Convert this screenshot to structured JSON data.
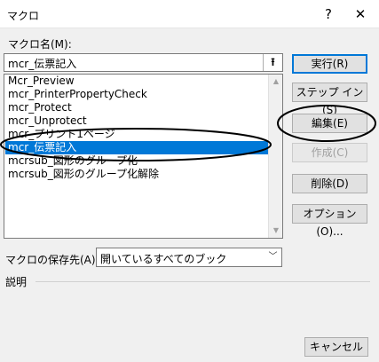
{
  "window": {
    "title": "マクロ",
    "help_icon": "question-icon",
    "close_icon": "close-icon"
  },
  "macro_name": {
    "label": "マクロ名(M):",
    "value": "mcr_伝票記入",
    "upload_icon": "upload-arrow-icon"
  },
  "macro_list": {
    "items": [
      "Mcr_Preview",
      "mcr_PrinterPropertyCheck",
      "mcr_Protect",
      "mcr_Unprotect",
      "mcr_プリント1ページ",
      "mcr_伝票記入",
      "mcrsub_図形のグループ化",
      "mcrsub_図形のグループ化解除"
    ],
    "selected_index": 5
  },
  "buttons": {
    "run": "実行(R)",
    "step_into": "ステップ イン(S)",
    "edit": "編集(E)",
    "create": "作成(C)",
    "delete": "削除(D)",
    "options": "オプション(O)..."
  },
  "store": {
    "label": "マクロの保存先(A):",
    "value": "開いているすべてのブック"
  },
  "description": {
    "label": "説明"
  },
  "cancel": {
    "label": "キャンセル"
  },
  "colors": {
    "selection": "#0078d7",
    "annotation": "#000000"
  }
}
